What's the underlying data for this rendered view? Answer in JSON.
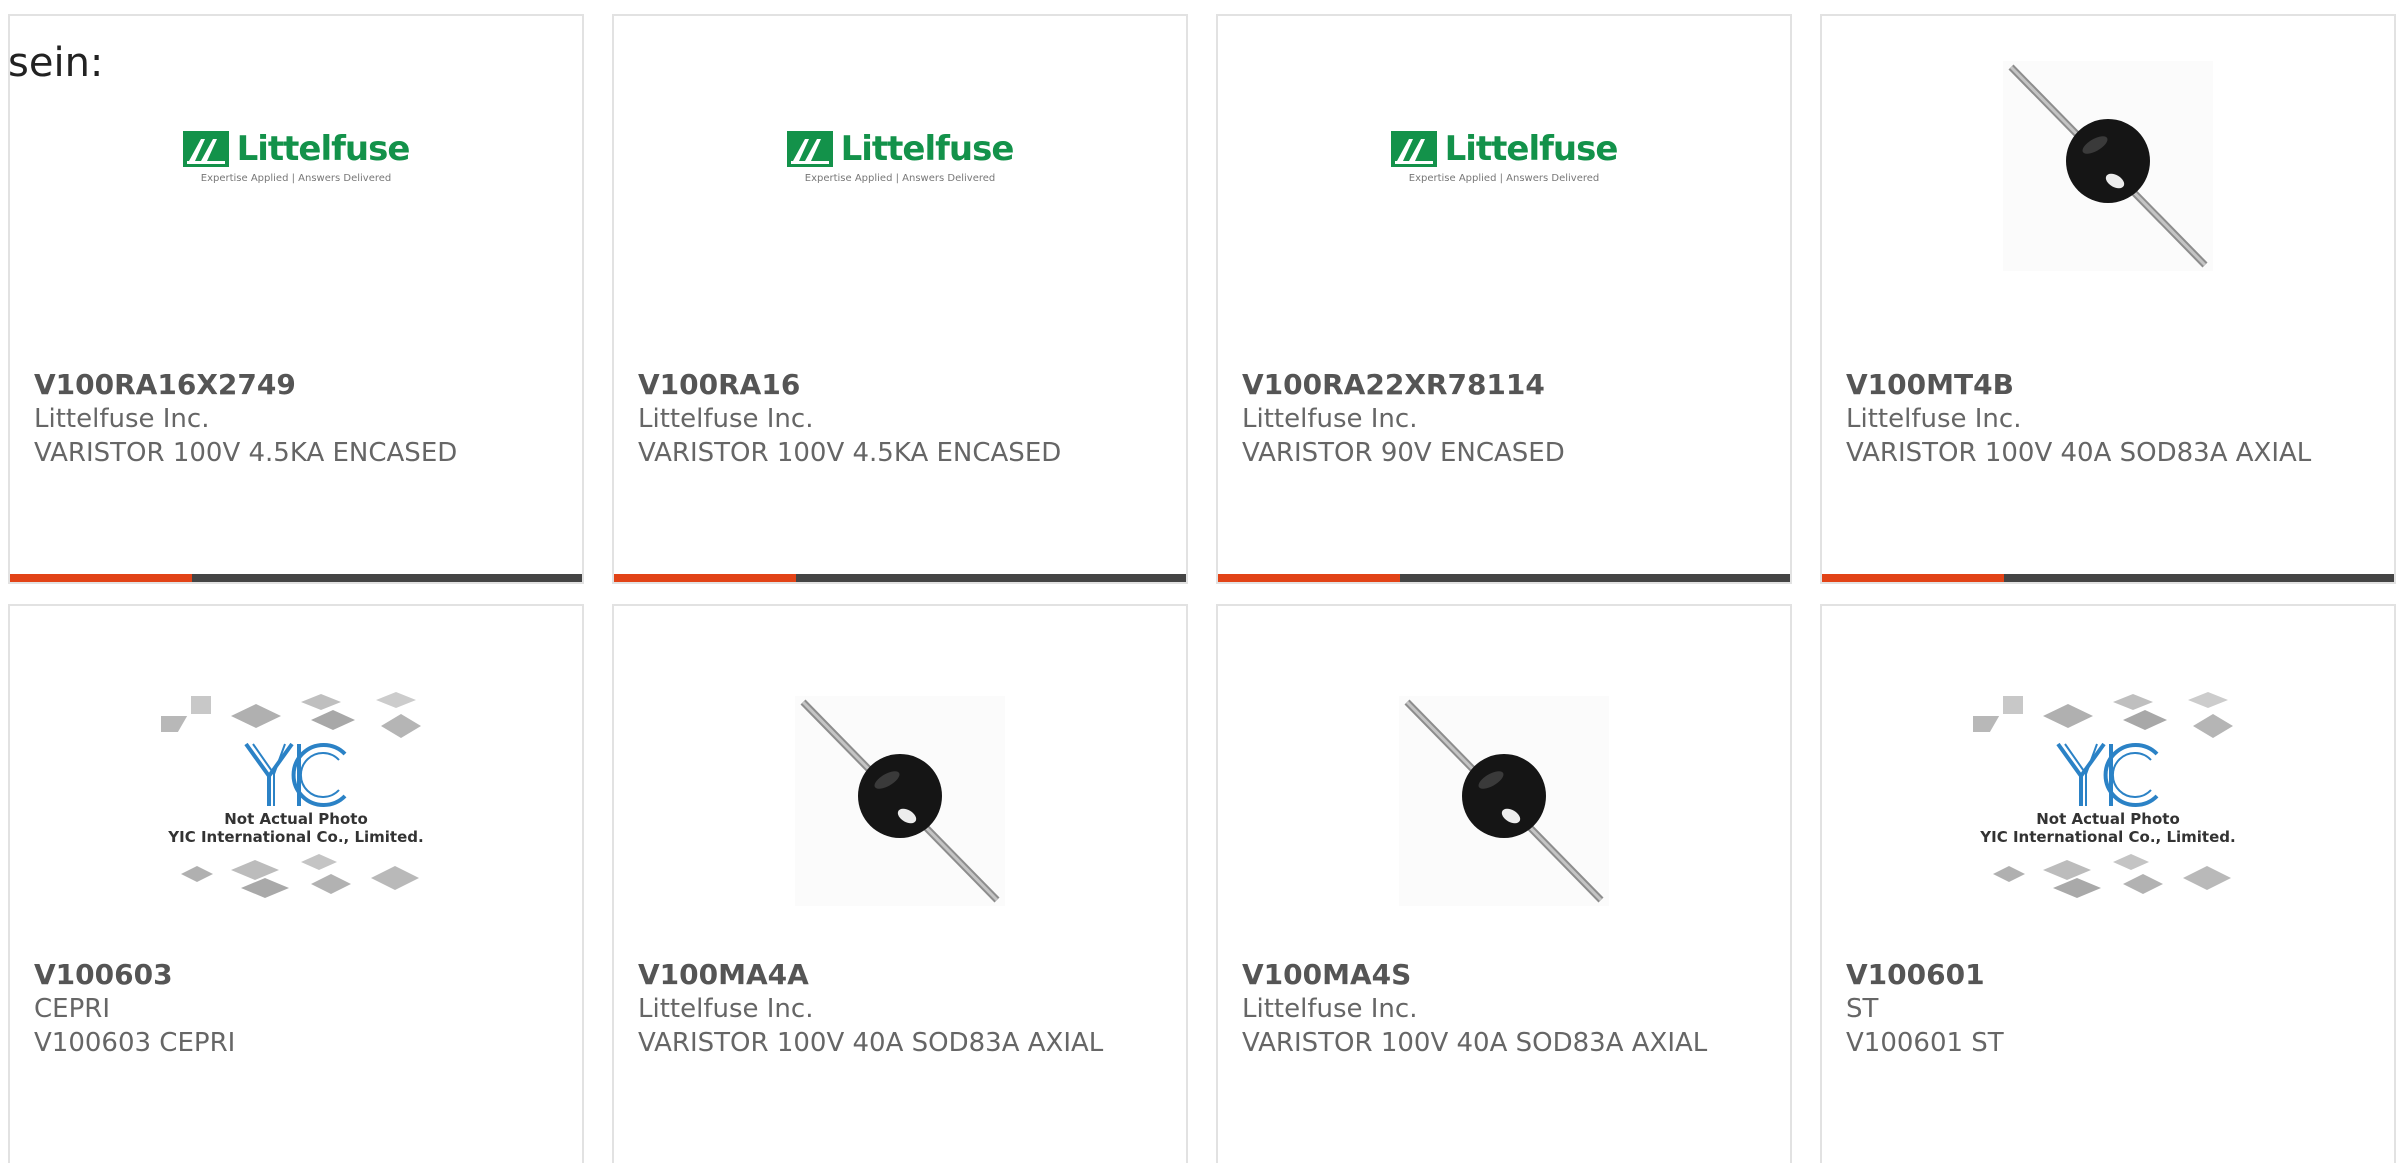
{
  "lead_text": "sein:",
  "colors": {
    "accent": "#e24317",
    "bar_dark": "#444444",
    "littelfuse_green": "#13924a",
    "yic_blue": "#2b82c6"
  },
  "cards": [
    {
      "part": "V100RA16X2749",
      "maker": "Littelfuse Inc.",
      "desc": "VARISTOR 100V 4.5KA ENCASED",
      "image": "littelfuse-logo"
    },
    {
      "part": "V100RA16",
      "maker": "Littelfuse Inc.",
      "desc": "VARISTOR 100V 4.5KA ENCASED",
      "image": "littelfuse-logo"
    },
    {
      "part": "V100RA22XR78114",
      "maker": "Littelfuse Inc.",
      "desc": "VARISTOR 90V ENCASED",
      "image": "littelfuse-logo"
    },
    {
      "part": "V100MT4B",
      "maker": "Littelfuse Inc.",
      "desc": "VARISTOR 100V 40A SOD83A AXIAL",
      "image": "axial-varistor-photo"
    },
    {
      "part": "V100603",
      "maker": "CEPRI",
      "desc": "V100603 CEPRI",
      "image": "yic-placeholder"
    },
    {
      "part": "V100MA4A",
      "maker": "Littelfuse Inc.",
      "desc": "VARISTOR 100V 40A SOD83A AXIAL",
      "image": "axial-varistor-photo"
    },
    {
      "part": "V100MA4S",
      "maker": "Littelfuse Inc.",
      "desc": "VARISTOR 100V 40A SOD83A AXIAL",
      "image": "axial-varistor-photo"
    },
    {
      "part": "V100601",
      "maker": "ST",
      "desc": "V100601 ST",
      "image": "yic-placeholder"
    }
  ],
  "logo_text": {
    "littelfuse_word": "Littelfuse",
    "littelfuse_tagline": "Expertise Applied | Answers Delivered",
    "yic_note_line1": "Not Actual Photo",
    "yic_note_line2": "YIC International Co., Limited."
  }
}
